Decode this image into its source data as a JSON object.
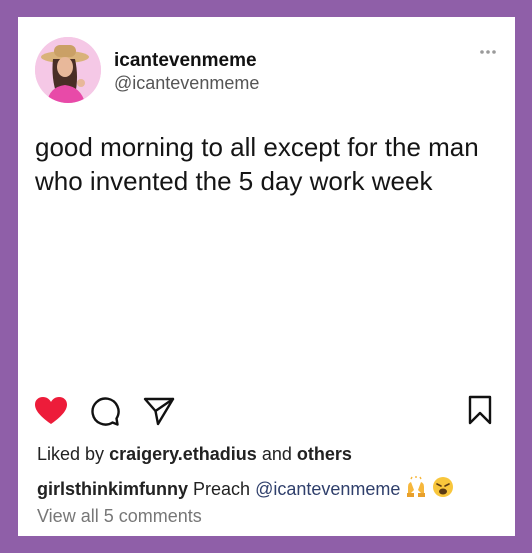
{
  "post": {
    "username": "icantevenmeme",
    "handle": "@icantevenmeme",
    "text": "good morning to all except for the man who invented the 5 day work week"
  },
  "actions": {
    "like_icon": "heart-filled-icon",
    "comment_icon": "speech-bubble-icon",
    "share_icon": "paper-plane-icon",
    "save_icon": "bookmark-icon",
    "like_color": "#ed1c3a"
  },
  "likes": {
    "prefix": "Liked by",
    "user": "craigery.ethadius",
    "and": "and",
    "others": "others"
  },
  "comment": {
    "author": "girlsthinkimfunny",
    "text": "Preach",
    "mention": "@icantevenmeme",
    "emojis": [
      "raising-hands-emoji",
      "weary-face-emoji"
    ]
  },
  "view_all_comments": "View all 5 comments",
  "colors": {
    "frame": "#8f5fa8",
    "card": "#ffffff"
  }
}
